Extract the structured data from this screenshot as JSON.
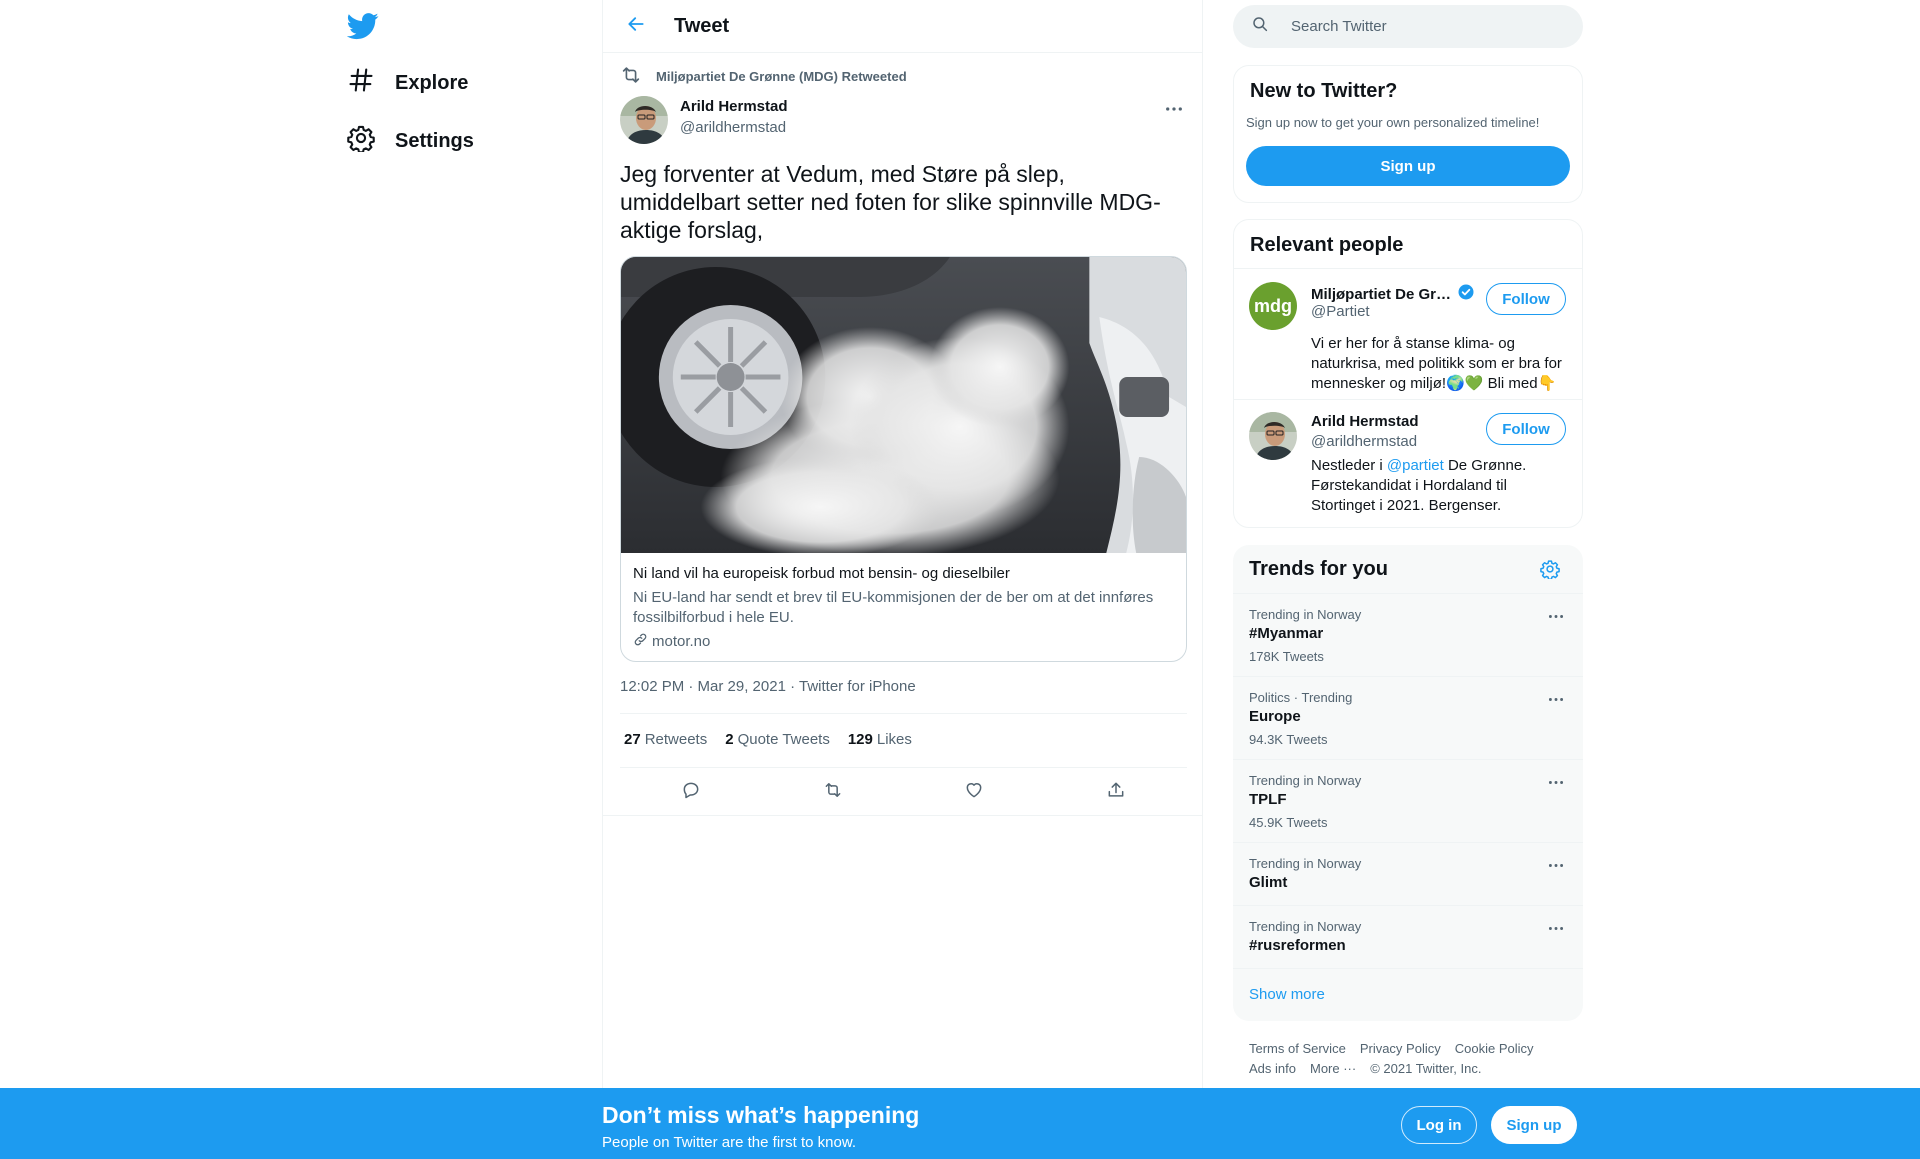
{
  "nav": {
    "logo_icon": "twitter-bird-icon",
    "items": [
      {
        "label": "Explore",
        "icon": "hashtag-icon"
      },
      {
        "label": "Settings",
        "icon": "gear-icon"
      }
    ]
  },
  "header": {
    "title": "Tweet",
    "back_icon": "arrow-left-icon"
  },
  "tweet": {
    "retweeted_by": "Miljøpartiet De Grønne (MDG) Retweeted",
    "author_name": "Arild Hermstad",
    "author_handle": "@arildhermstad",
    "text": "Jeg forventer at Vedum, med Støre på slep, umiddelbart setter ned foten for slike spinnville MDG-aktige forslag,",
    "card": {
      "title": "Ni land vil ha europeisk forbud mot bensin- og dieselbiler",
      "description": "Ni EU-land har sendt et brev til EU-kommisjonen der de ber om at det innføres fossilbilforbud i hele EU.",
      "domain": "motor.no"
    },
    "timestamp": "12:02 PM · Mar 29, 2021 · Twitter for iPhone",
    "stats": {
      "retweets_count": "27",
      "retweets_label": "Retweets",
      "quotes_count": "2",
      "quotes_label": "Quote Tweets",
      "likes_count": "129",
      "likes_label": "Likes"
    }
  },
  "search": {
    "placeholder": "Search Twitter"
  },
  "new_to_twitter": {
    "title": "New to Twitter?",
    "subtitle": "Sign up now to get your own personalized timeline!",
    "button": "Sign up"
  },
  "relevant_people": {
    "title": "Relevant people",
    "people": [
      {
        "name": "Miljøpartiet De Gr…",
        "handle": "@Partiet",
        "avatar_text": "mdg",
        "follow": "Follow",
        "bio": "Vi er her for å stanse klima- og naturkrisa, med politikk som er bra for mennesker og miljø!🌍💚 Bli med👇"
      },
      {
        "name": "Arild Hermstad",
        "handle": "@arildhermstad",
        "follow": "Follow",
        "bio_prefix": "Nestleder i ",
        "bio_mention": "@partiet",
        "bio_suffix": " De Grønne. Førstekandidat i Hordaland til Stortinget i 2021. Bergenser."
      }
    ]
  },
  "trends": {
    "title": "Trends for you",
    "items": [
      {
        "meta": "Trending in Norway",
        "name": "#Myanmar",
        "count": "178K Tweets"
      },
      {
        "meta": "Politics · Trending",
        "name": "Europe",
        "count": "94.3K Tweets"
      },
      {
        "meta": "Trending in Norway",
        "name": "TPLF",
        "count": "45.9K Tweets"
      },
      {
        "meta": "Trending in Norway",
        "name": "Glimt",
        "count": ""
      },
      {
        "meta": "Trending in Norway",
        "name": "#rusreformen",
        "count": ""
      }
    ],
    "show_more": "Show more"
  },
  "footer": {
    "terms": "Terms of Service",
    "privacy": "Privacy Policy",
    "cookie": "Cookie Policy",
    "ads": "Ads info",
    "more": "More ···",
    "copyright": "© 2021 Twitter, Inc."
  },
  "banner": {
    "title": "Don’t miss what’s happening",
    "subtitle": "People on Twitter are the first to know.",
    "login": "Log in",
    "signup": "Sign up"
  },
  "colors": {
    "accent": "#1d9bf0",
    "text": "#0f1419",
    "muted": "#536471",
    "mdg_green": "#6aa02e"
  }
}
